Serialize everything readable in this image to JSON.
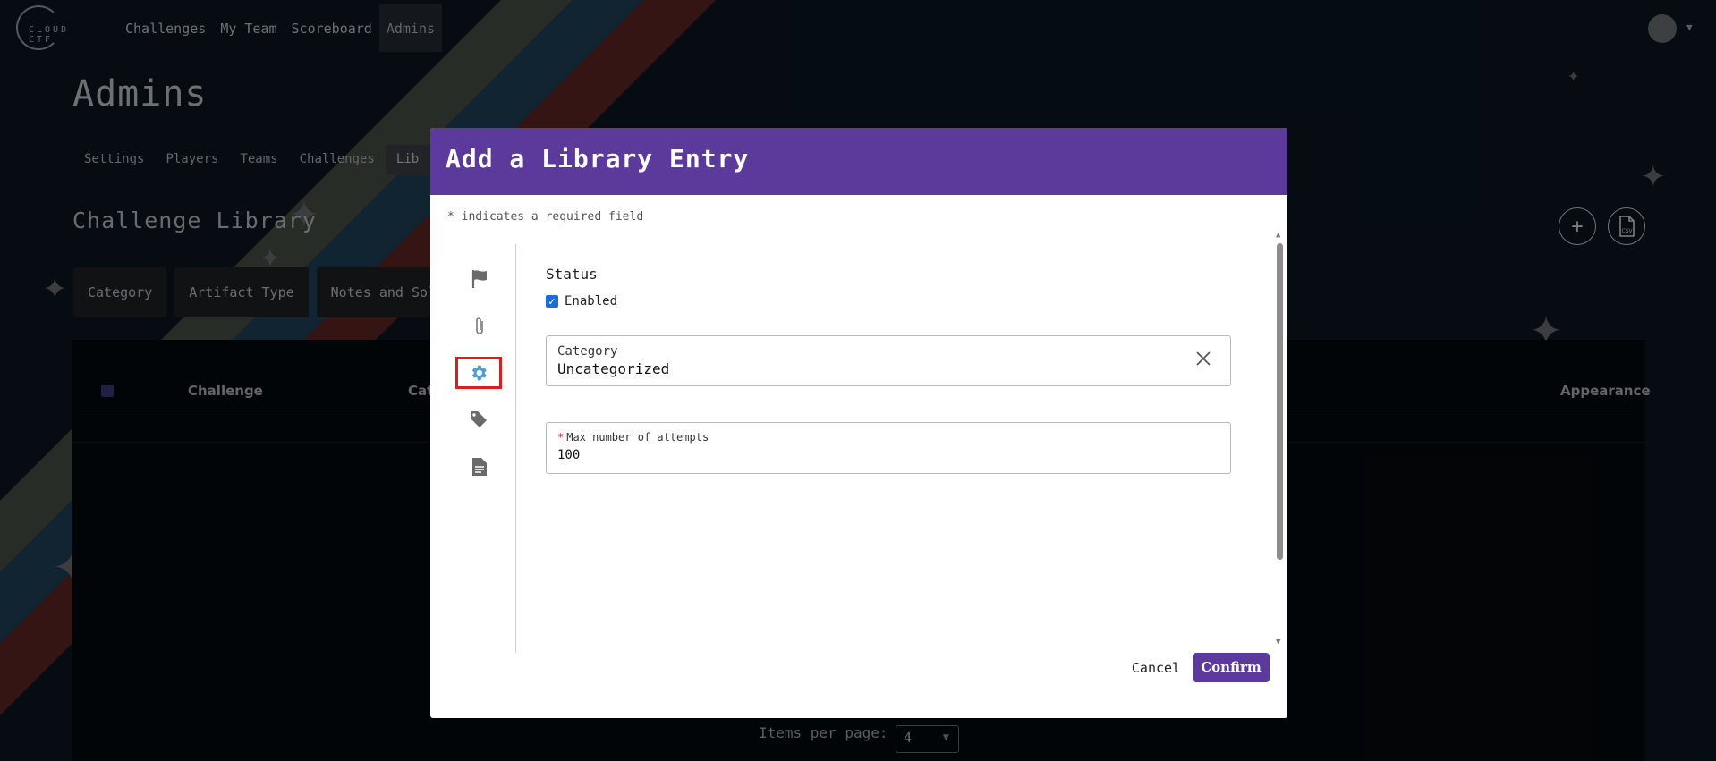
{
  "nav": {
    "logo_text": "CLOUD CTF",
    "links": [
      {
        "label": "Challenges"
      },
      {
        "label": "My Team"
      },
      {
        "label": "Scoreboard"
      },
      {
        "label": "Admins"
      }
    ]
  },
  "page": {
    "title": "Admins",
    "tabs": [
      {
        "label": "Settings"
      },
      {
        "label": "Players"
      },
      {
        "label": "Teams"
      },
      {
        "label": "Challenges"
      },
      {
        "label": "Lib"
      }
    ],
    "section_title": "Challenge Library",
    "filters": [
      {
        "label": "Category"
      },
      {
        "label": "Artifact Type"
      },
      {
        "label": "Notes and Solu"
      }
    ],
    "table_headers": {
      "challenge": "Challenge",
      "category": "Cat",
      "appearance": "Appearance"
    },
    "items_per_page_label": "Items per page:",
    "items_per_page_value": "4"
  },
  "modal": {
    "title": "Add a Library Entry",
    "required_note": "* indicates a required field",
    "side_icons": [
      "flag-icon",
      "paperclip-icon",
      "gear-icon",
      "tag-icon",
      "document-icon"
    ],
    "status_label": "Status",
    "enabled_label": "Enabled",
    "enabled_checked": true,
    "category_label": "Category",
    "category_value": "Uncategorized",
    "max_attempts_label": "Max number of attempts",
    "max_attempts_value": "100",
    "cancel_label": "Cancel",
    "confirm_label": "Confirm"
  },
  "colors": {
    "modal_header": "#5b3a9b",
    "confirm_button": "#5b3a9b",
    "active_icon_highlight": "#d71f1f",
    "checkbox": "#1a6fd6"
  }
}
